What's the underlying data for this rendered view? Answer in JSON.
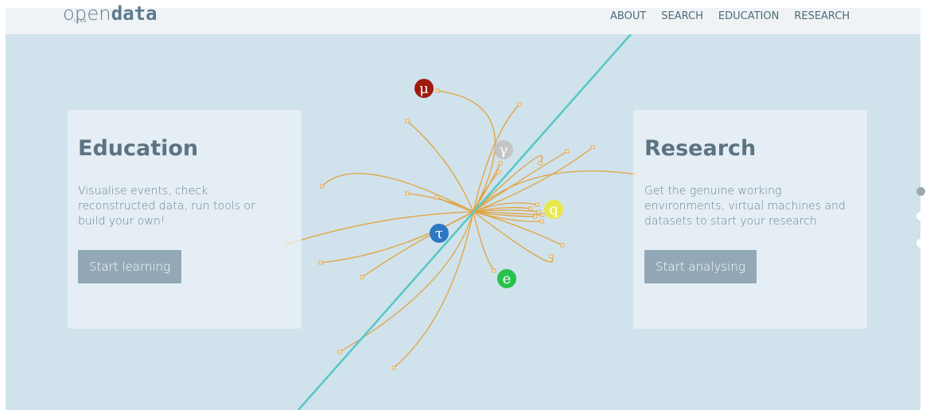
{
  "header": {
    "logo_text_open": "open",
    "logo_text_data": "data",
    "logo_subtext": "CERN",
    "nav": [
      {
        "label": "ABOUT"
      },
      {
        "label": "SEARCH"
      },
      {
        "label": "EDUCATION"
      },
      {
        "label": "RESEARCH"
      }
    ]
  },
  "cards": {
    "education": {
      "title": "Education",
      "description_lines": [
        "Visualise events, check",
        "reconstructed data, run tools or",
        "build your own!"
      ],
      "button_label": "Start learning"
    },
    "research": {
      "title": "Research",
      "description_lines": [
        "Get the genuine working",
        "environments, virtual machines and",
        "datasets to start your research"
      ],
      "button_label": "Start analysing"
    }
  },
  "particles": [
    {
      "symbol": "μ",
      "name": "muon",
      "color": "#9e1b0f"
    },
    {
      "symbol": "γ",
      "name": "photon",
      "color": "#c4c4c4"
    },
    {
      "symbol": "q",
      "name": "quark",
      "color": "#e9e84b"
    },
    {
      "symbol": "τ",
      "name": "tau",
      "color": "#2e77c4"
    },
    {
      "symbol": "e",
      "name": "electron",
      "color": "#27c24e"
    }
  ],
  "colors": {
    "background": "#d0e2ec",
    "track": "#e3a23c",
    "beam": "#56c8c8",
    "button": "#92a8b6"
  },
  "carousel": {
    "slides": 3,
    "active_index": 0
  }
}
